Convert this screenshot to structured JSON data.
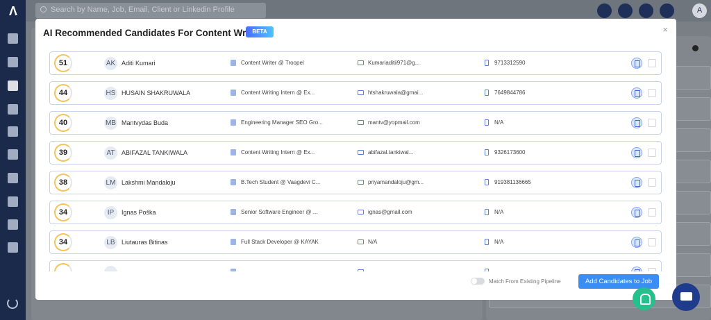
{
  "search": {
    "placeholder": "Search by Name, Job, Email, Client or Linkedin Profile"
  },
  "topbar": {
    "user_initial": "A"
  },
  "modal": {
    "title": "AI Recommended Candidates For Content Writer",
    "badge": "BETA",
    "close_icon": "×",
    "toggle_label": "Match From Existing Pipeline",
    "add_button": "Add Candidates to Job"
  },
  "candidates": [
    {
      "score": "51",
      "initials": "AK",
      "name": "Aditi Kumari",
      "job": "Content Writer @ Troopel",
      "email": "Kumariaditii971@g...",
      "phone": "9713312590"
    },
    {
      "score": "44",
      "initials": "HS",
      "name": "HUSAIN SHAKRUWALA",
      "job": "Content Writing Intern @ Ex...",
      "email": "htshakruwala@gmai...",
      "phone": "7649844786"
    },
    {
      "score": "40",
      "initials": "MB",
      "name": "Mantvydas Buda",
      "job": "Engineering Manager SEO Gro...",
      "email": "mantv@yopmail.com",
      "phone": "N/A"
    },
    {
      "score": "39",
      "initials": "AT",
      "name": "ABIFAZAL TANKIWALA",
      "job": "Content Writing Intern @ Ex...",
      "email": "abifazal.tankiwal...",
      "phone": "9326173600"
    },
    {
      "score": "38",
      "initials": "LM",
      "name": "Lakshmi Mandaloju",
      "job": "B.Tech Student @ Vaagdevi C...",
      "email": "priyamandaloju@gm...",
      "phone": "919381136665"
    },
    {
      "score": "34",
      "initials": "IP",
      "name": "Ignas Poška",
      "job": "Senior Software Engineer @ ...",
      "email": "ignas@gmail.com",
      "phone": "N/A"
    },
    {
      "score": "34",
      "initials": "LB",
      "name": "Liutauras Bitinas",
      "job": "Full Stack Developer @ KAYAK",
      "email": "N/A",
      "phone": "N/A"
    },
    {
      "score": "",
      "initials": "",
      "name": "",
      "job": "",
      "email": "",
      "phone": ""
    }
  ]
}
